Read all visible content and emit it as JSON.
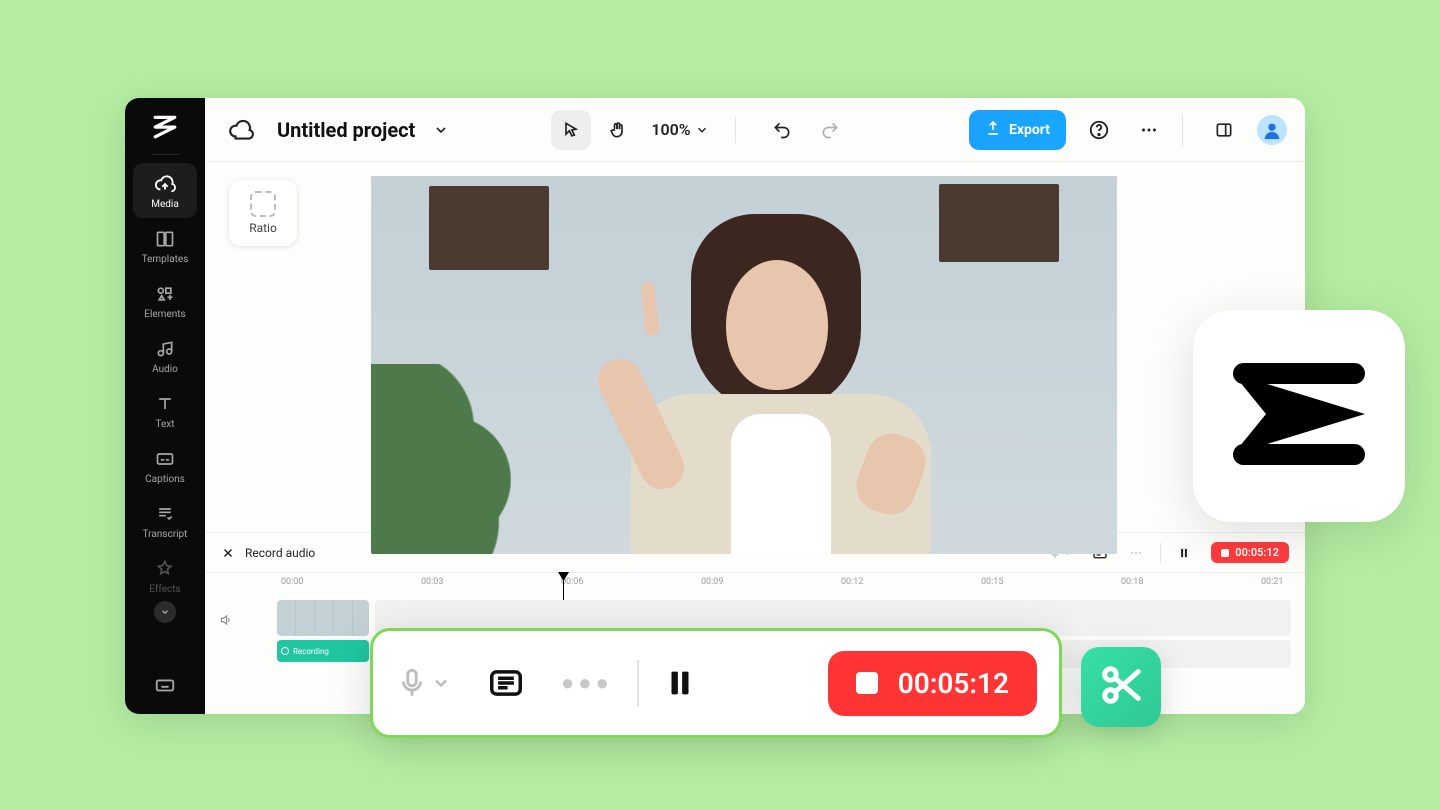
{
  "header": {
    "project_title": "Untitled project",
    "zoom_label": "100%",
    "export_label": "Export"
  },
  "sidebar": {
    "items": [
      {
        "label": "Media"
      },
      {
        "label": "Templates"
      },
      {
        "label": "Elements"
      },
      {
        "label": "Audio"
      },
      {
        "label": "Text"
      },
      {
        "label": "Captions"
      },
      {
        "label": "Transcript"
      },
      {
        "label": "Effects"
      }
    ]
  },
  "canvas": {
    "ratio_label": "Ratio"
  },
  "controls": {
    "record_audio_label": "Record audio",
    "recording_time": "00:05:12"
  },
  "timeline": {
    "ticks": [
      "00:00",
      "00:03",
      "00:06",
      "00:09",
      "00:12",
      "00:15",
      "00:18",
      "00:21"
    ],
    "audio_clip_label": "Recording"
  },
  "big_bar": {
    "recording_time": "00:05:12"
  }
}
